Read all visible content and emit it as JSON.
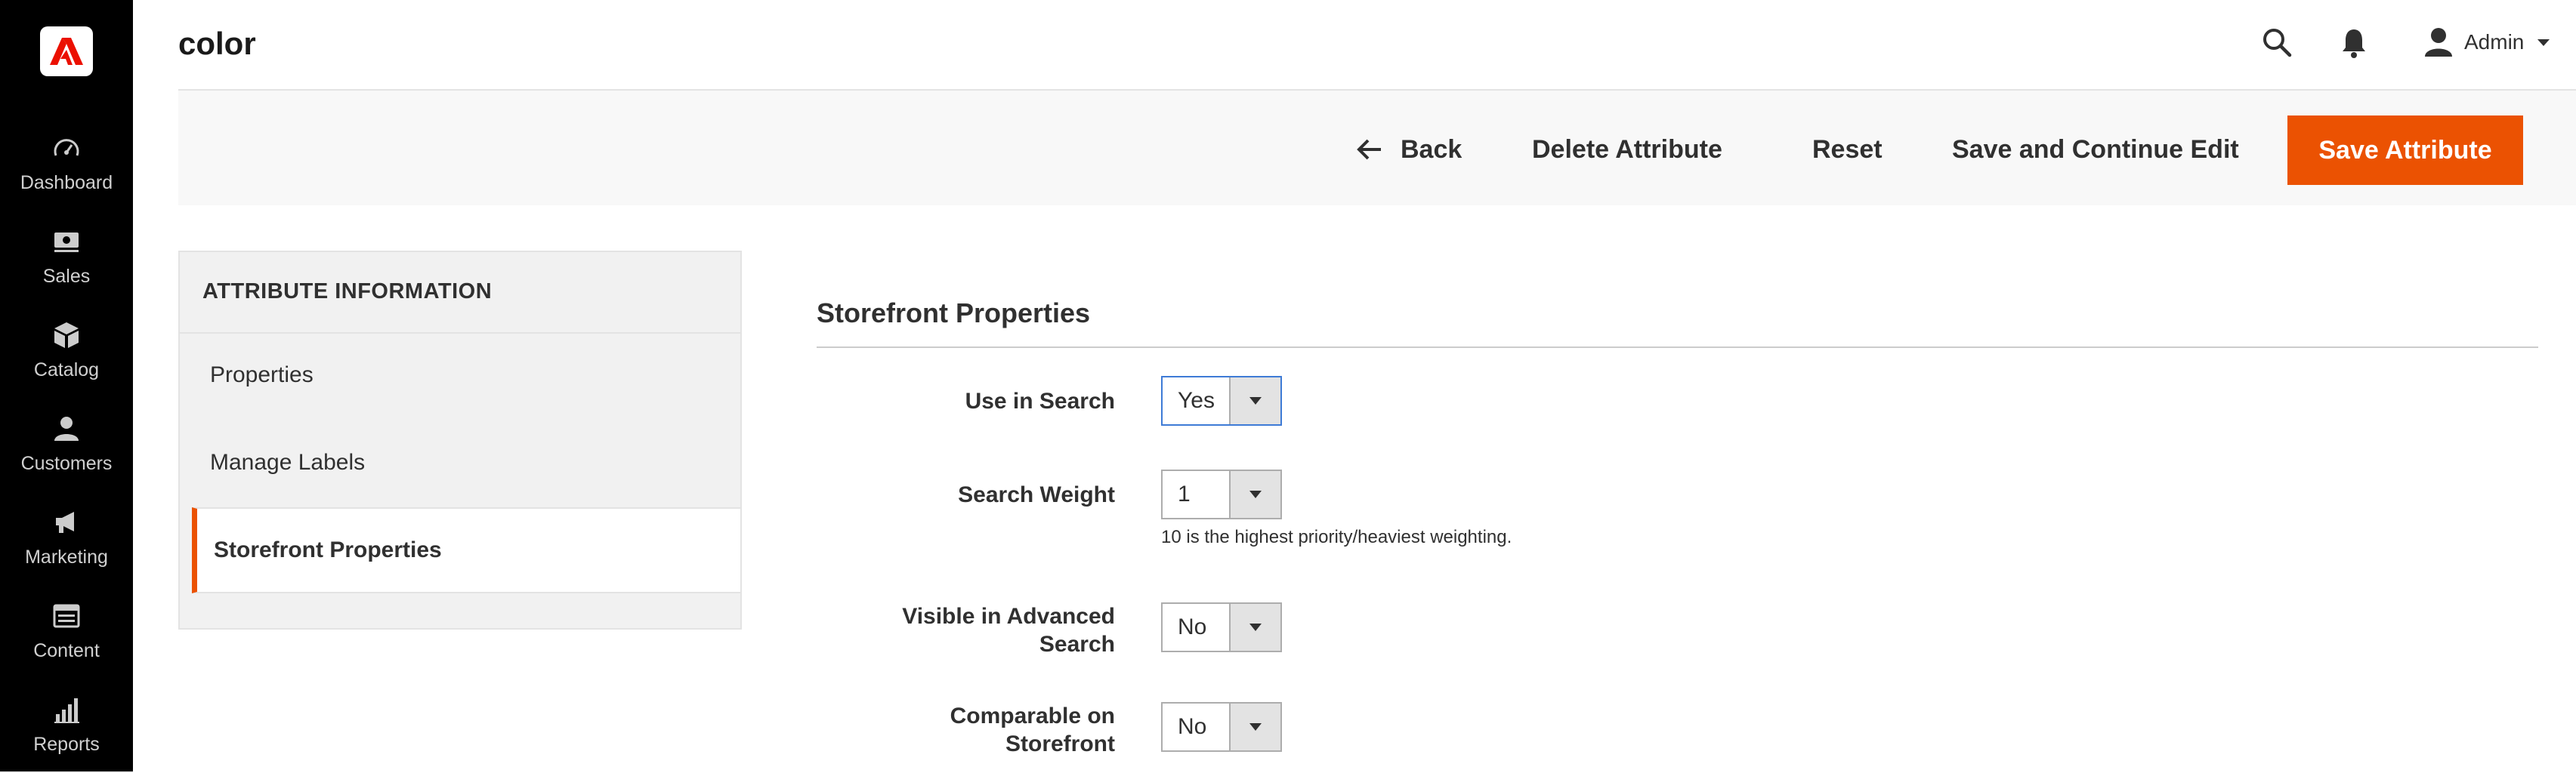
{
  "sidebar": {
    "items": [
      {
        "label": "Dashboard",
        "icon": "dashboard-gauge-icon"
      },
      {
        "label": "Sales",
        "icon": "sales-cash-icon"
      },
      {
        "label": "Catalog",
        "icon": "catalog-box-icon"
      },
      {
        "label": "Customers",
        "icon": "customers-people-icon"
      },
      {
        "label": "Marketing",
        "icon": "marketing-megaphone-icon"
      },
      {
        "label": "Content",
        "icon": "content-layout-icon"
      },
      {
        "label": "Reports",
        "icon": "reports-bars-icon"
      }
    ]
  },
  "header": {
    "title": "color",
    "user_name": "Admin"
  },
  "actions": {
    "back_label": "Back",
    "delete_label": "Delete Attribute",
    "reset_label": "Reset",
    "save_continue_label": "Save and Continue Edit",
    "save_label": "Save Attribute"
  },
  "tabs": {
    "title": "ATTRIBUTE INFORMATION",
    "items": [
      {
        "label": "Properties",
        "active": false
      },
      {
        "label": "Manage Labels",
        "active": false
      },
      {
        "label": "Storefront Properties",
        "active": true
      }
    ]
  },
  "form": {
    "section_title": "Storefront Properties",
    "fields": [
      {
        "label": "Use in Search",
        "value": "Yes"
      },
      {
        "label": "Search Weight",
        "value": "1",
        "note": "10 is the highest priority/heaviest weighting."
      },
      {
        "label_line1": "Visible in Advanced",
        "label_line2": "Search",
        "value": "No"
      },
      {
        "label_line1": "Comparable on",
        "label_line2": "Storefront",
        "value": "No"
      }
    ]
  },
  "colors": {
    "accent": "#eb5202",
    "sidebar_bg": "#000000",
    "focus": "#3e7bd6"
  }
}
